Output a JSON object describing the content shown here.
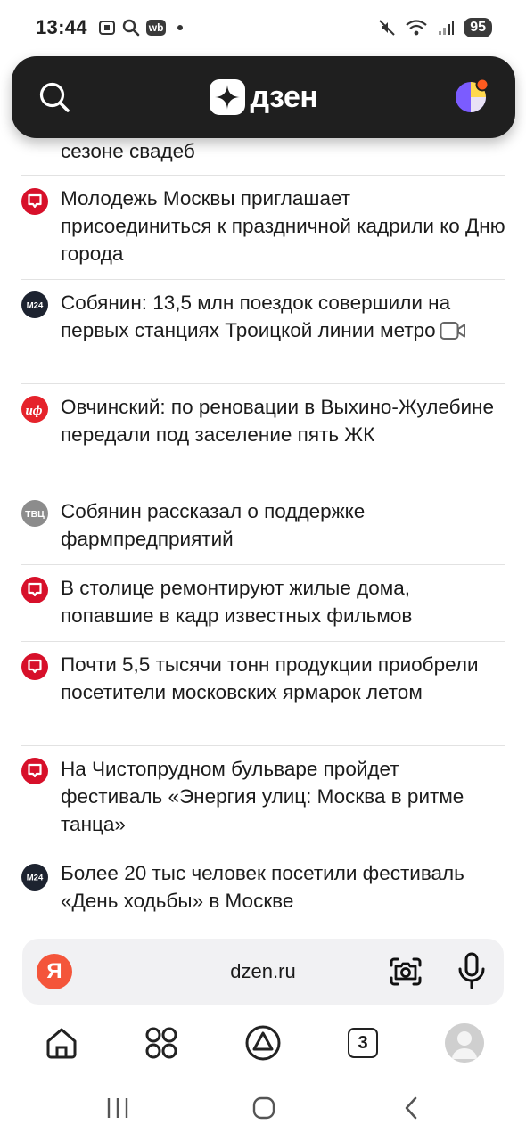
{
  "status_bar": {
    "time": "13:44",
    "wb_label": "wb",
    "battery": "95",
    "icons": [
      "screenshot-icon",
      "search-icon",
      "wb-icon",
      "dot-icon",
      "mute-icon",
      "wifi-icon",
      "signal-icon",
      "battery-icon"
    ]
  },
  "header": {
    "logo_text": "дзен",
    "icons": [
      "search-icon",
      "dzen-logo-icon",
      "profile-avatar-icon"
    ]
  },
  "feed": {
    "items": [
      {
        "title": "сезоне свадеб",
        "source_icon": "none",
        "video": false
      },
      {
        "title": "Молодежь Москвы приглашает присоединиться к праздничной кадрили ко Дню города",
        "source_icon": "mos-icon",
        "video": false
      },
      {
        "title": "Собянин: 13,5 млн поездок совершили на первых станциях Троицкой линии метро",
        "source_icon": "m24-icon",
        "source_label": "M24",
        "video": true
      },
      {
        "title": "Овчинский: по реновации в Выхино-Жулебине передали под заселение пять ЖК",
        "source_icon": "aif-icon",
        "source_label": "иф",
        "video": false
      },
      {
        "title": "Собянин рассказал о поддержке фармпредприятий",
        "source_icon": "tvc-icon",
        "source_label": "ТВЦ",
        "video": false
      },
      {
        "title": "В столице ремонтируют жилые дома, попавшие в кадр известных фильмов",
        "source_icon": "mos-icon",
        "video": false
      },
      {
        "title": "Почти 5,5 тысячи тонн продукции приобрели посетители московских ярмарок летом",
        "source_icon": "mos-icon",
        "video": false
      },
      {
        "title": "На Чистопрудном бульваре пройдет фестиваль «Энергия улиц: Москва в ритме танца»",
        "source_icon": "mos-icon",
        "video": false
      },
      {
        "title": "Более 20 тыс человек посетили фестиваль «День ходьбы» в Москве",
        "source_icon": "m24-icon",
        "source_label": "M24",
        "video": false
      }
    ]
  },
  "address_bar": {
    "yandex_label": "Я",
    "url": "dzen.ru",
    "icons": [
      "camera-search-icon",
      "microphone-icon"
    ]
  },
  "browser_nav": {
    "tabs_count": "3",
    "icons": [
      "home-icon",
      "services-grid-icon",
      "alice-icon",
      "tabs-icon",
      "profile-icon"
    ]
  },
  "system_nav": {
    "icons": [
      "recents-icon",
      "home-circle-icon",
      "back-icon"
    ]
  },
  "colors": {
    "header_bg": "#1f1f1f",
    "mos_red": "#d7102a",
    "m24_dark": "#1d2330",
    "aif_red": "#e5232b",
    "tvc_gray": "#8c8c8c",
    "yandex_red": "#f4553a",
    "divider": "#e2e2e2"
  }
}
